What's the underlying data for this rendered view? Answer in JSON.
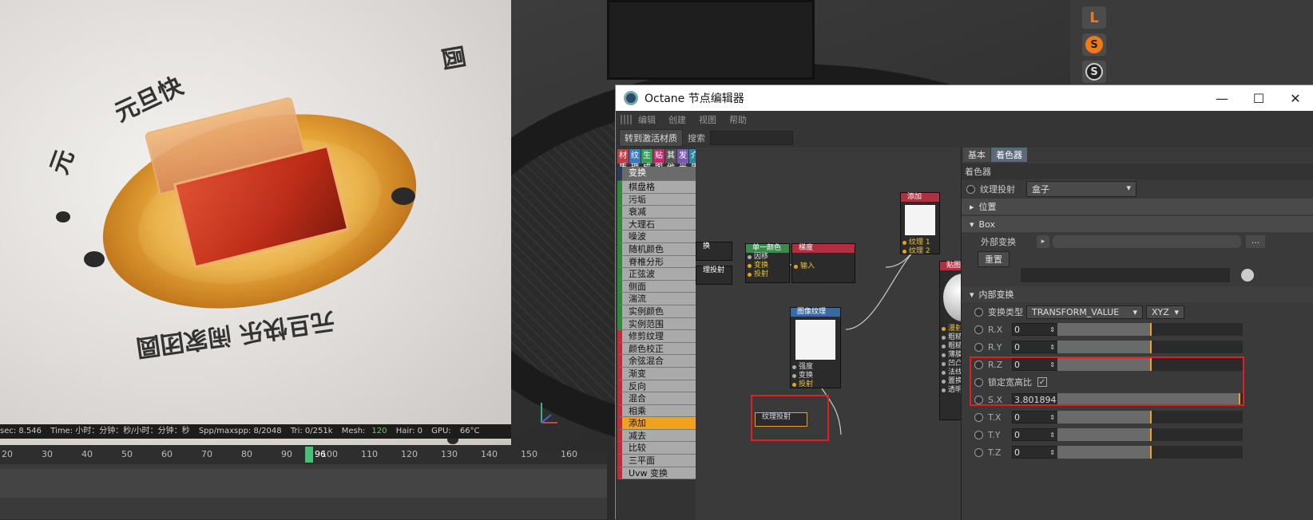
{
  "render_view": {
    "ring_text_top": "元旦快",
    "ring_text_bottom": "元旦快乐 闹家团圆",
    "ring_char_left": "元",
    "ring_char_right": "圆"
  },
  "status_bar": {
    "sec": "sec: 8.546",
    "time": "Time: 小时：分钟：秒/小时：分钟：秒",
    "spp": "Spp/maxspp: 8/2048",
    "tri": "Tri: 0/251k",
    "mesh_label": "Mesh:",
    "mesh_value": "120",
    "hair": "Hair: 0",
    "gpu": "GPU:",
    "temp": "66°C"
  },
  "timeline": {
    "ticks": [
      "20",
      "30",
      "40",
      "50",
      "60",
      "70",
      "80",
      "90",
      "100",
      "110",
      "120",
      "130",
      "140",
      "150",
      "160"
    ],
    "current_frame": "96"
  },
  "right_tools": [
    "L",
    "S",
    "S"
  ],
  "editor": {
    "title": "Octane 节点编辑器",
    "window_controls": [
      "—",
      "☐",
      "✕"
    ],
    "menu": [
      "编辑",
      "创建",
      "视图",
      "帮助"
    ],
    "toolbar": {
      "goto_label": "转到激活材质",
      "search_label": "搜索"
    },
    "category_tabs": [
      {
        "label": "材质",
        "color": "#c03a4a"
      },
      {
        "label": "纹理",
        "color": "#3a7ac0"
      },
      {
        "label": "生成",
        "color": "#3a9a5a"
      },
      {
        "label": "贴图",
        "color": "#c02a6a"
      },
      {
        "label": "其他",
        "color": "#555555"
      },
      {
        "label": "发光",
        "color": "#7a5ab0"
      },
      {
        "label": "介质",
        "color": "#2a8aa0"
      },
      {
        "label": "C4D",
        "color": "#888888"
      }
    ],
    "node_list": {
      "header": "变换",
      "green_items": [
        "棋盘格",
        "污垢",
        "衰减",
        "大理石",
        "噪波",
        "随机颜色",
        "脊椎分形",
        "正弦波",
        "侧面",
        "湍流",
        "实例颜色",
        "实例范围"
      ],
      "red_items": [
        "修剪纹理",
        "颜色校正",
        "余弦混合",
        "渐变",
        "反向",
        "混合",
        "相乘",
        "添加",
        "减去",
        "比较",
        "三平面",
        "Uvw 变换"
      ],
      "selected": "添加"
    },
    "nodes": {
      "n_cut1": {
        "title": "换"
      },
      "n_cut2": {
        "title": "理投射"
      },
      "n_single": {
        "title": "单一颜色",
        "ports": [
          "因移",
          "变换",
          "投射"
        ]
      },
      "n_gradient": {
        "title": "梯度",
        "ports": [
          "输入"
        ]
      },
      "n_add": {
        "title": "添加",
        "ports": [
          "纹理 1",
          "纹理 2"
        ]
      },
      "n_map": {
        "title": "贴图",
        "ports": [
          "漫射",
          "粗糙",
          "粗糙度",
          "薄膜宽度",
          "凹凸",
          "法线",
          "置换",
          "透明度"
        ]
      },
      "n_image": {
        "title": "图像纹理",
        "ports": [
          "强度",
          "变换",
          "投射"
        ]
      },
      "n_proj": {
        "title": "纹理投射"
      }
    },
    "right_panel": {
      "tabs": [
        "基本",
        "着色器"
      ],
      "active_tab": "着色器",
      "section_title": "着色器",
      "texture_projection_label": "纹理投射",
      "texture_projection_value": "盒子",
      "position_label": "位置",
      "box_label": "Box",
      "external_transform_label": "外部变换",
      "reset_button": "重置",
      "more_button": "...",
      "inner_transform_label": "内部变换",
      "transform_type_label": "变换类型",
      "transform_type_value": "TRANSFORM_VALUE",
      "axis_order_value": "XYZ",
      "lock_aspect_label": "锁定宽高比",
      "lock_aspect_check": "✓",
      "fields": [
        {
          "label": "R.X",
          "value": "0",
          "level": 0.5
        },
        {
          "label": "R.Y",
          "value": "0",
          "level": 0.5
        },
        {
          "label": "R.Z",
          "value": "0",
          "level": 0.5
        },
        {
          "label": "S.X",
          "value": "3.801894",
          "level": 0.98
        },
        {
          "label": "T.X",
          "value": "0",
          "level": 0.5
        },
        {
          "label": "T.Y",
          "value": "0",
          "level": 0.5
        },
        {
          "label": "T.Z",
          "value": "0",
          "level": 0.5
        }
      ]
    }
  },
  "colors": {
    "accent": "#f0a21e",
    "highlight": "#e02020",
    "playhead": "#4bbf7a"
  }
}
